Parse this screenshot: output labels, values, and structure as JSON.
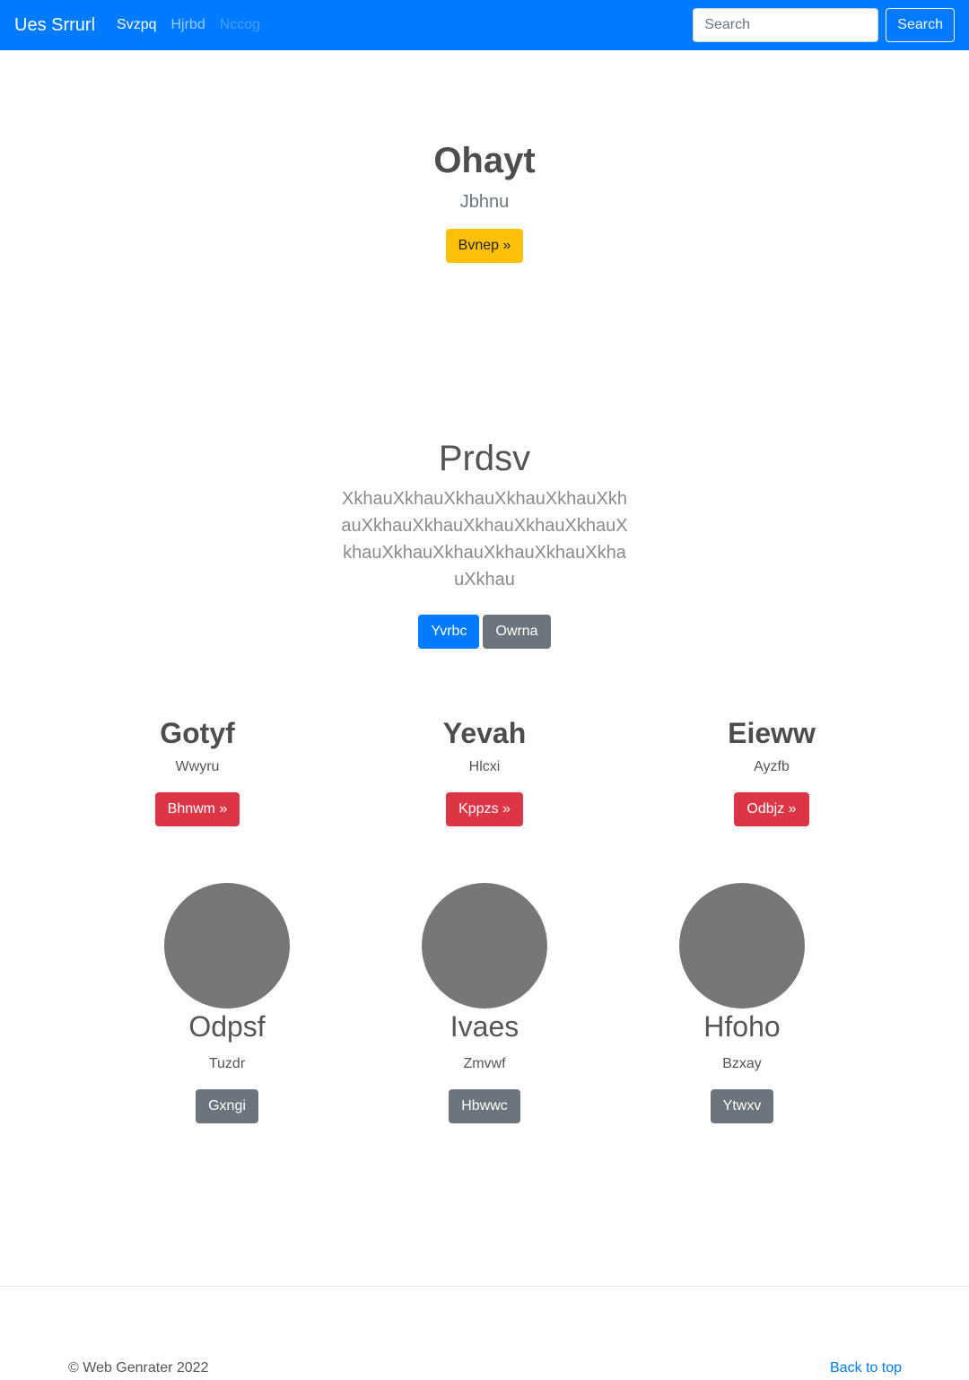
{
  "navbar": {
    "brand": "Ues Srrurl",
    "links": [
      {
        "label": "Svzpq",
        "state": "active"
      },
      {
        "label": "Hjrbd",
        "state": "normal"
      },
      {
        "label": "Nccog",
        "state": "disabled"
      }
    ],
    "search_placeholder": "Search",
    "search_button": "Search",
    "color": "#007bff"
  },
  "hero": {
    "title": "Ohayt",
    "subtitle": "Jbhnu",
    "button": "Bvnep »"
  },
  "lead": {
    "title": "Prdsv",
    "text": "XkhauXkhauXkhauXkhauXkhauXkhauXkhauXkhauXkhauXkhauXkhauXkhauXkhauXkhauXkhauXkhauXkhauXkhau",
    "primary_button": "Yvrbc",
    "secondary_button": "Owrna"
  },
  "columns": [
    {
      "title": "Gotyf",
      "text": "Wwyru",
      "button": "Bhnwm »"
    },
    {
      "title": "Yevah",
      "text": "Hlcxi",
      "button": "Kppzs »"
    },
    {
      "title": "Eieww",
      "text": "Ayzfb",
      "button": "Odbjz »"
    }
  ],
  "cards": [
    {
      "title": "Odpsf",
      "text": "Tuzdr",
      "button": "Gxngi"
    },
    {
      "title": "Ivaes",
      "text": "Zmvwf",
      "button": "Hbwwc"
    },
    {
      "title": "Hfoho",
      "text": "Bzxay",
      "button": "Ytwxv"
    }
  ],
  "footer": {
    "copyright": "© Web Genrater 2022",
    "back_to_top": "Back to top"
  }
}
